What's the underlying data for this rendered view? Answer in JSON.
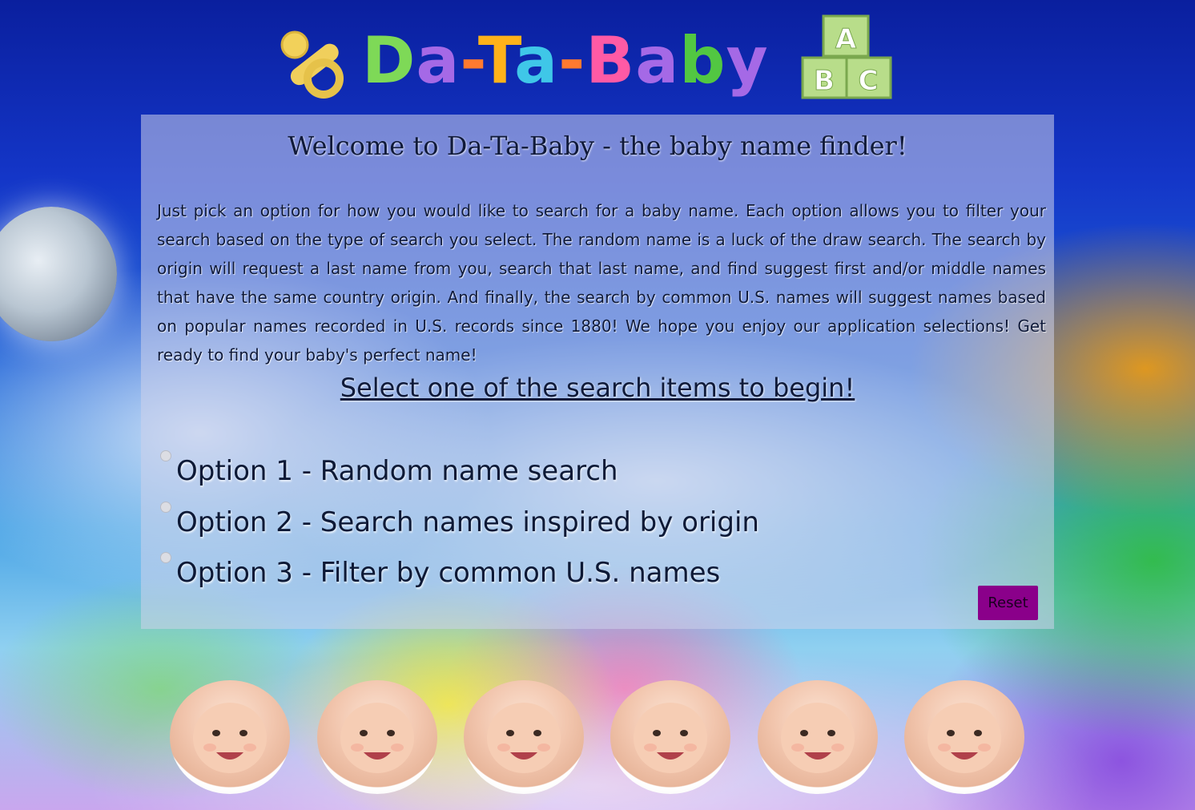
{
  "logo": {
    "letters": [
      "D",
      "a",
      "-",
      "T",
      "a",
      "-",
      "B",
      "a",
      "b",
      "y"
    ],
    "letter_colors": [
      "#7ed957",
      "#a569e6",
      "#ff7a30",
      "#ffb21a",
      "#3fc7e8",
      "#ff7a30",
      "#ff5aa5",
      "#a569e6",
      "#52c742",
      "#a569e6"
    ],
    "block_letters": [
      "A",
      "B",
      "C"
    ]
  },
  "panel": {
    "welcome": "Welcome to Da-Ta-Baby - the baby name finder!",
    "intro": "Just pick an option for how you would like to search for a baby name. Each option allows you to filter your search based on the type of search you select. The random name is a luck of the draw search. The search by origin will request a last name from you, search that last name, and find suggest first and/or middle names that have the same country origin. And finally, the search by common U.S. names will suggest names based on popular names recorded in U.S. records since 1880! We hope you enjoy our application selections! Get ready to find your baby's perfect name!",
    "select_heading": "Select one of the search items to begin!",
    "options": [
      {
        "label": "Option 1 - Random name search"
      },
      {
        "label": "Option 2 - Search names inspired by origin"
      },
      {
        "label": "Option 3 - Filter by common U.S. names"
      }
    ],
    "reset_label": "Reset"
  },
  "babies": [
    "baby-photo-1",
    "baby-photo-2",
    "baby-photo-3",
    "baby-photo-4",
    "baby-photo-5",
    "baby-photo-6"
  ]
}
